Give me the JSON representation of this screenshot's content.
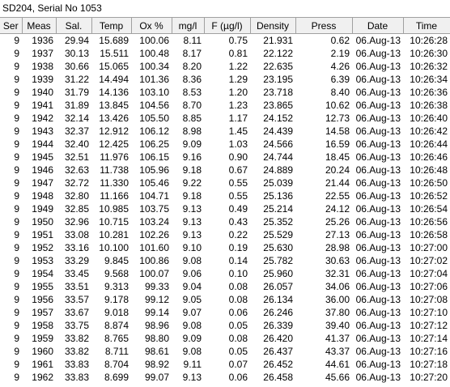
{
  "window": {
    "title": "SD204, Serial No 1053"
  },
  "table": {
    "columns": [
      "Ser",
      "Meas",
      "Sal.",
      "Temp",
      "Ox %",
      "mg/l",
      "F (µg/l)",
      "Density",
      "Press",
      "Date",
      "Time"
    ],
    "rows": [
      [
        "9",
        "1936",
        "29.94",
        "15.689",
        "100.06",
        "8.11",
        "0.75",
        "21.931",
        "0.62",
        "06.Aug-13",
        "10:26:28"
      ],
      [
        "9",
        "1937",
        "30.13",
        "15.511",
        "100.48",
        "8.17",
        "0.81",
        "22.122",
        "2.19",
        "06.Aug-13",
        "10:26:30"
      ],
      [
        "9",
        "1938",
        "30.66",
        "15.065",
        "100.34",
        "8.20",
        "1.22",
        "22.635",
        "4.26",
        "06.Aug-13",
        "10:26:32"
      ],
      [
        "9",
        "1939",
        "31.22",
        "14.494",
        "101.36",
        "8.36",
        "1.29",
        "23.195",
        "6.39",
        "06.Aug-13",
        "10:26:34"
      ],
      [
        "9",
        "1940",
        "31.79",
        "14.136",
        "103.10",
        "8.53",
        "1.20",
        "23.718",
        "8.40",
        "06.Aug-13",
        "10:26:36"
      ],
      [
        "9",
        "1941",
        "31.89",
        "13.845",
        "104.56",
        "8.70",
        "1.23",
        "23.865",
        "10.62",
        "06.Aug-13",
        "10:26:38"
      ],
      [
        "9",
        "1942",
        "32.14",
        "13.426",
        "105.50",
        "8.85",
        "1.17",
        "24.152",
        "12.73",
        "06.Aug-13",
        "10:26:40"
      ],
      [
        "9",
        "1943",
        "32.37",
        "12.912",
        "106.12",
        "8.98",
        "1.45",
        "24.439",
        "14.58",
        "06.Aug-13",
        "10:26:42"
      ],
      [
        "9",
        "1944",
        "32.40",
        "12.425",
        "106.25",
        "9.09",
        "1.03",
        "24.566",
        "16.59",
        "06.Aug-13",
        "10:26:44"
      ],
      [
        "9",
        "1945",
        "32.51",
        "11.976",
        "106.15",
        "9.16",
        "0.90",
        "24.744",
        "18.45",
        "06.Aug-13",
        "10:26:46"
      ],
      [
        "9",
        "1946",
        "32.63",
        "11.738",
        "105.96",
        "9.18",
        "0.67",
        "24.889",
        "20.24",
        "06.Aug-13",
        "10:26:48"
      ],
      [
        "9",
        "1947",
        "32.72",
        "11.330",
        "105.46",
        "9.22",
        "0.55",
        "25.039",
        "21.44",
        "06.Aug-13",
        "10:26:50"
      ],
      [
        "9",
        "1948",
        "32.80",
        "11.166",
        "104.71",
        "9.18",
        "0.55",
        "25.136",
        "22.55",
        "06.Aug-13",
        "10:26:52"
      ],
      [
        "9",
        "1949",
        "32.85",
        "10.985",
        "103.75",
        "9.13",
        "0.49",
        "25.214",
        "24.12",
        "06.Aug-13",
        "10:26:54"
      ],
      [
        "9",
        "1950",
        "32.96",
        "10.715",
        "103.24",
        "9.13",
        "0.43",
        "25.352",
        "25.26",
        "06.Aug-13",
        "10:26:56"
      ],
      [
        "9",
        "1951",
        "33.08",
        "10.281",
        "102.26",
        "9.13",
        "0.22",
        "25.529",
        "27.13",
        "06.Aug-13",
        "10:26:58"
      ],
      [
        "9",
        "1952",
        "33.16",
        "10.100",
        "101.60",
        "9.10",
        "0.19",
        "25.630",
        "28.98",
        "06.Aug-13",
        "10:27:00"
      ],
      [
        "9",
        "1953",
        "33.29",
        "9.845",
        "100.86",
        "9.08",
        "0.14",
        "25.782",
        "30.63",
        "06.Aug-13",
        "10:27:02"
      ],
      [
        "9",
        "1954",
        "33.45",
        "9.568",
        "100.07",
        "9.06",
        "0.10",
        "25.960",
        "32.31",
        "06.Aug-13",
        "10:27:04"
      ],
      [
        "9",
        "1955",
        "33.51",
        "9.313",
        "99.33",
        "9.04",
        "0.08",
        "26.057",
        "34.06",
        "06.Aug-13",
        "10:27:06"
      ],
      [
        "9",
        "1956",
        "33.57",
        "9.178",
        "99.12",
        "9.05",
        "0.08",
        "26.134",
        "36.00",
        "06.Aug-13",
        "10:27:08"
      ],
      [
        "9",
        "1957",
        "33.67",
        "9.018",
        "99.14",
        "9.07",
        "0.06",
        "26.246",
        "37.80",
        "06.Aug-13",
        "10:27:10"
      ],
      [
        "9",
        "1958",
        "33.75",
        "8.874",
        "98.96",
        "9.08",
        "0.05",
        "26.339",
        "39.40",
        "06.Aug-13",
        "10:27:12"
      ],
      [
        "9",
        "1959",
        "33.82",
        "8.765",
        "98.80",
        "9.09",
        "0.08",
        "26.420",
        "41.37",
        "06.Aug-13",
        "10:27:14"
      ],
      [
        "9",
        "1960",
        "33.82",
        "8.711",
        "98.61",
        "9.08",
        "0.05",
        "26.437",
        "43.37",
        "06.Aug-13",
        "10:27:16"
      ],
      [
        "9",
        "1961",
        "33.83",
        "8.704",
        "98.92",
        "9.11",
        "0.07",
        "26.452",
        "44.61",
        "06.Aug-13",
        "10:27:18"
      ],
      [
        "9",
        "1962",
        "33.83",
        "8.699",
        "99.07",
        "9.13",
        "0.06",
        "26.458",
        "45.66",
        "06.Aug-13",
        "10:27:20"
      ]
    ]
  }
}
